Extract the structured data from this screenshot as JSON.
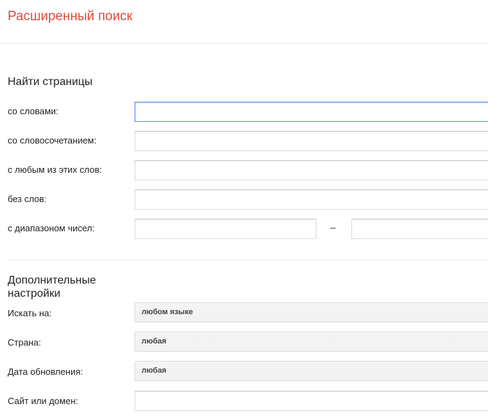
{
  "header": {
    "title": "Расширенный поиск"
  },
  "find_pages": {
    "title": "Найти страницы",
    "fields": [
      {
        "label": "со словами:",
        "value": ""
      },
      {
        "label": "со словосочетанием:",
        "value": ""
      },
      {
        "label": "с любым из этих слов:",
        "value": ""
      },
      {
        "label": "без слов:",
        "value": ""
      }
    ],
    "range": {
      "label": "с диапазоном чисел:",
      "from_value": "",
      "separator": "–",
      "to_value": ""
    }
  },
  "additional": {
    "title": "Дополнительные настройки",
    "language": {
      "label": "Искать на:",
      "value": "любом языке"
    },
    "country": {
      "label": "Страна:",
      "value": "любая"
    },
    "updated": {
      "label": "Дата обновления:",
      "value": "любая"
    },
    "site": {
      "label": "Сайт или домен:",
      "value": ""
    }
  },
  "colors": {
    "title": "#dd4b39",
    "focus_border": "#4d90fe",
    "select_bg": "#f1f1f1"
  }
}
